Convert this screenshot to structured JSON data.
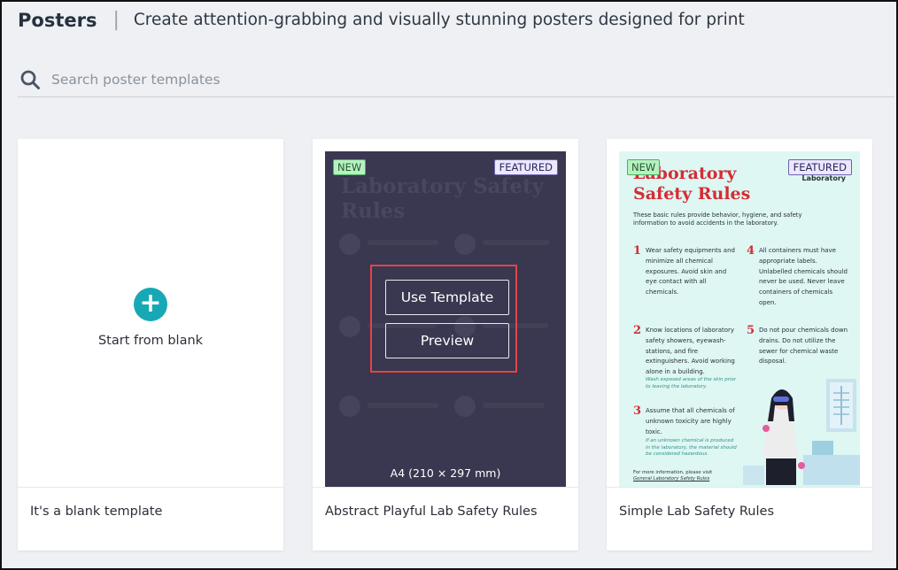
{
  "header": {
    "title": "Posters",
    "separator": "|",
    "subtitle": "Create attention-grabbing and visually stunning posters designed for print"
  },
  "search": {
    "placeholder": "Search poster templates",
    "icon": "search-icon"
  },
  "cards": [
    {
      "thumb_text": "Start from blank",
      "label": "It's a blank template",
      "icon": "plus-icon"
    },
    {
      "label": "Abstract Playful Lab Safety Rules",
      "badge_new": "NEW",
      "badge_featured": "FEATURED",
      "faded_title": "Laboratory Safety Rules",
      "use_template_label": "Use Template",
      "preview_label": "Preview",
      "size": "A4 (210 × 297 mm)"
    },
    {
      "label": "Simple Lab Safety Rules",
      "badge_new": "NEW",
      "badge_featured": "FEATURED",
      "poster": {
        "title": "Laboratory Safety Rules",
        "brand": "Laboratory",
        "intro": "These basic rules provide behavior, hygiene, and safety information to avoid accidents in the laboratory.",
        "rules": [
          {
            "num": "1",
            "text": "Wear safety equipments and minimize all chemical exposures. Avoid skin and eye contact with all chemicals."
          },
          {
            "num": "4",
            "text": "All containers must have appropriate labels. Unlabelled chemicals should never be used. Never leave containers of chemicals open."
          },
          {
            "num": "2",
            "text": "Know locations of laboratory safety showers, eyewash-stations, and fire extinguishers. Avoid working alone in a building.",
            "note": "Wash exposed areas of the skin prior to leaving the laboratory."
          },
          {
            "num": "5",
            "text": "Do not pour chemicals down drains. Do not utilize the sewer for chemical waste disposal."
          },
          {
            "num": "3",
            "text": "Assume that all chemicals of unknown toxicity are highly toxic.",
            "note": "If an unknown chemical is produced in the laboratory, the material should be considered hazardous."
          }
        ],
        "footer_text": "For more information, please visit",
        "footer_link": "General Laboratory Safety Rules"
      }
    }
  ],
  "colors": {
    "accent_teal": "#17a8b5",
    "dark_poster": "#393850",
    "mint_poster": "#def7f3",
    "poster_red": "#d32d34",
    "highlight_red": "#e04545"
  }
}
